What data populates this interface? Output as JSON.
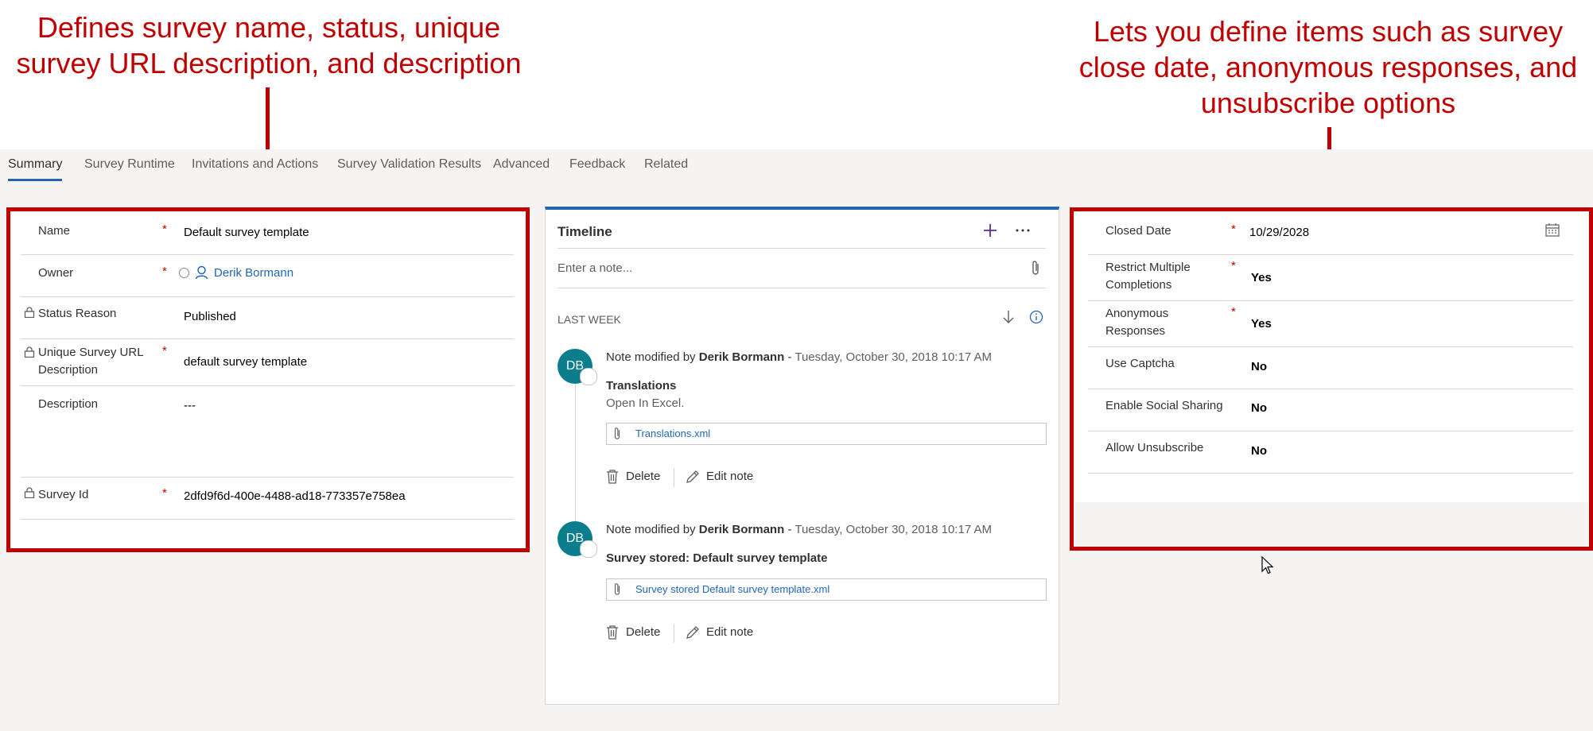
{
  "annotations": {
    "left_callout": [
      "Defines survey name, status, unique",
      "survey URL description, and description"
    ],
    "right_callout": [
      "Lets you define items such as survey",
      "close date, anonymous responses, and",
      "unsubscribe options"
    ]
  },
  "tabs": [
    "Summary",
    "Survey Runtime",
    "Invitations and Actions",
    "Survey Validation Results",
    "Advanced",
    "Feedback",
    "Related"
  ],
  "general": {
    "name_label": "Name",
    "name_value": "Default survey template",
    "owner_label": "Owner",
    "owner_value": "Derik Bormann",
    "status_label": "Status Reason",
    "status_value": "Published",
    "url_label_1": "Unique Survey URL",
    "url_label_2": "Description",
    "url_value": "default survey template",
    "description_label": "Description",
    "description_value": "---",
    "survey_id_label": "Survey Id",
    "survey_id_value": "2dfd9f6d-400e-4488-ad18-773357e758ea",
    "required_mark": "*"
  },
  "timeline": {
    "title": "Timeline",
    "note_placeholder": "Enter a note...",
    "section": "LAST WEEK",
    "entries": [
      {
        "initials": "DB",
        "prefix": "Note modified by",
        "author": "Derik Bormann",
        "separator": "-",
        "date": "Tuesday, October 30, 2018 10:17 AM",
        "title": "Translations",
        "body": "Open In Excel.",
        "attachment": "Translations.xml",
        "delete": "Delete",
        "edit": "Edit note"
      },
      {
        "initials": "DB",
        "prefix": "Note modified by",
        "author": "Derik Bormann",
        "separator": "-",
        "date": "Tuesday, October 30, 2018 10:17 AM",
        "title": "Survey stored: Default survey template",
        "attachment": "Survey stored Default survey template.xml",
        "delete": "Delete",
        "edit": "Edit note"
      }
    ]
  },
  "options": {
    "closed_date_label": "Closed Date",
    "closed_date_value": "10/29/2028",
    "restrict_label_1": "Restrict Multiple",
    "restrict_label_2": "Completions",
    "restrict_value": "Yes",
    "anon_label_1": "Anonymous",
    "anon_label_2": "Responses",
    "anon_value": "Yes",
    "captcha_label": "Use Captcha",
    "captcha_value": "No",
    "social_label": "Enable Social Sharing",
    "social_value": "No",
    "unsub_label": "Allow Unsubscribe",
    "unsub_value": "No"
  },
  "colors": {
    "annotation": "#c00000",
    "accent": "#2266b2",
    "avatar": "#0a7e8c"
  }
}
